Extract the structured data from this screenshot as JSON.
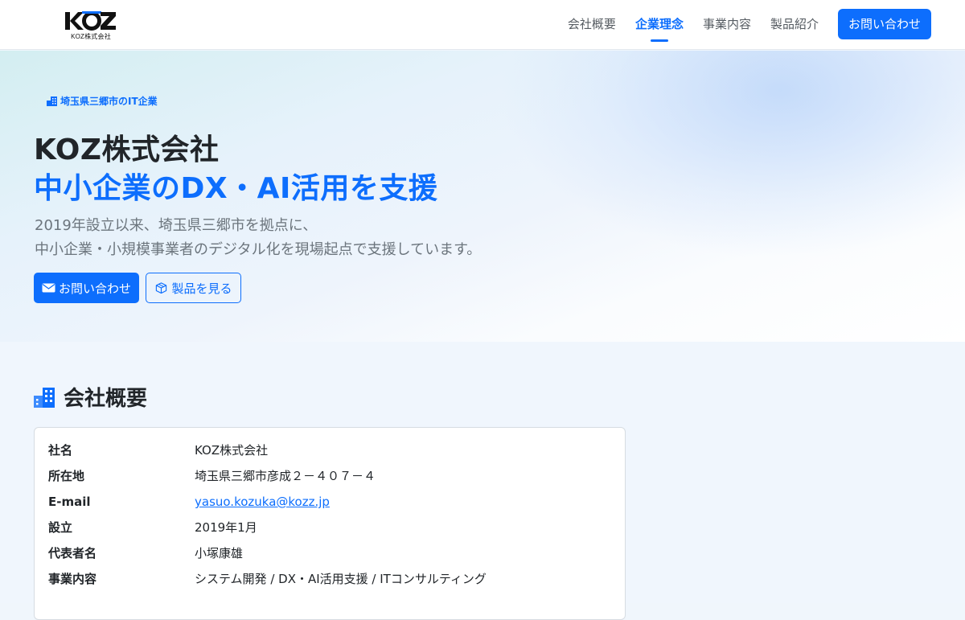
{
  "header": {
    "logo_text": "KOZ",
    "logo_subtitle": "KOZ株式会社",
    "nav": [
      {
        "label": "会社概要",
        "active": false
      },
      {
        "label": "企業理念",
        "active": true
      },
      {
        "label": "事業内容",
        "active": false
      },
      {
        "label": "製品紹介",
        "active": false
      }
    ],
    "cta_label": "お問い合わせ"
  },
  "hero": {
    "badge": "埼玉県三郷市のIT企業",
    "badge_icon": "building-icon",
    "title": "KOZ株式会社",
    "subtitle": "中小企業のDX・AI活用を支援",
    "desc_line1": "2019年設立以来、埼玉県三郷市を拠点に、",
    "desc_line2": "中小企業・小規模事業者のデジタル化を現場起点で支援しています。",
    "primary_button": "お問い合わせ",
    "primary_icon": "envelope-icon",
    "secondary_button": "製品を見る",
    "secondary_icon": "box-icon"
  },
  "company": {
    "section_title": "会社概要",
    "section_icon": "buildings-icon",
    "rows": [
      {
        "key": "社名",
        "value": "KOZ株式会社"
      },
      {
        "key": "所在地",
        "value": "埼玉県三郷市彦成２－４０７－４"
      },
      {
        "key": "E-mail",
        "value": "yasuo.kozuka@kozz.jp"
      },
      {
        "key": "設立",
        "value": "2019年1月"
      },
      {
        "key": "代表者名",
        "value": "小塚康雄"
      },
      {
        "key": "事業内容",
        "value": "システム開発 / DX・AI活用支援 / ITコンサルティング"
      }
    ]
  },
  "colors": {
    "accent": "#0d6efd",
    "text": "#212529",
    "muted": "#6c757d"
  }
}
